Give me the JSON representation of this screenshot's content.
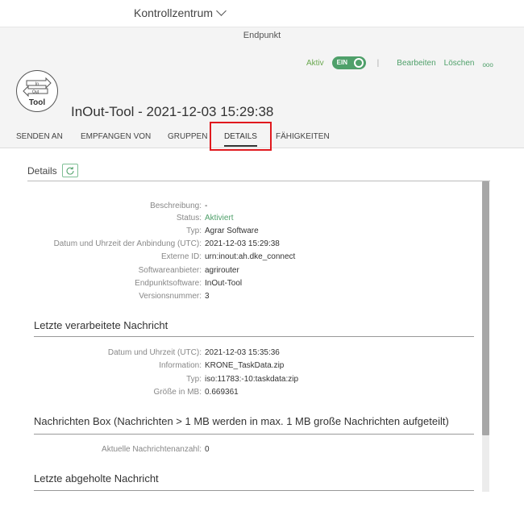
{
  "topbar": {
    "title": "Kontrollzentrum"
  },
  "subbar": {
    "label": "Endpunkt"
  },
  "header": {
    "logo_text": "Tool",
    "logo_in": "In",
    "logo_out": "Out",
    "title": "InOut-Tool - 2021-12-03 15:29:38",
    "status_label": "Aktiv",
    "toggle_label": "EIN",
    "edit_label": "Bearbeiten",
    "delete_label": "Löschen",
    "more_label": "ooo"
  },
  "tabs": [
    {
      "label": "SENDEN AN"
    },
    {
      "label": "EMPFANGEN VON"
    },
    {
      "label": "GRUPPEN"
    },
    {
      "label": "DETAILS",
      "active": true
    },
    {
      "label": "FÄHIGKEITEN"
    }
  ],
  "details": {
    "title": "Details",
    "rows": [
      {
        "key": "Beschreibung:",
        "value": "-"
      },
      {
        "key": "Status:",
        "value": "Aktiviert"
      },
      {
        "key": "Typ:",
        "value": "Agrar Software"
      },
      {
        "key": "Datum und Uhrzeit der Anbindung (UTC):",
        "value": "2021-12-03 15:29:38"
      },
      {
        "key": "Externe ID:",
        "value": "urn:inout:ah.dke_connect"
      },
      {
        "key": "Softwareanbieter:",
        "value": "agrirouter"
      },
      {
        "key": "Endpunktsoftware:",
        "value": "InOut-Tool"
      },
      {
        "key": "Versionsnummer:",
        "value": "3"
      }
    ]
  },
  "last_processed": {
    "title": "Letzte verarbeitete Nachricht",
    "rows": [
      {
        "key": "Datum und Uhrzeit (UTC):",
        "value": "2021-12-03 15:35:36"
      },
      {
        "key": "Information:",
        "value": "KRONE_TaskData.zip"
      },
      {
        "key": "Typ:",
        "value": "iso:11783:-10:taskdata:zip"
      },
      {
        "key": "Größe in MB:",
        "value": "0.669361"
      }
    ]
  },
  "message_box": {
    "title": "Nachrichten Box (Nachrichten > 1 MB werden in max. 1 MB große Nachrichten aufgeteilt)",
    "rows": [
      {
        "key": "Aktuelle Nachrichtenanzahl:",
        "value": "0"
      }
    ]
  },
  "last_fetched": {
    "title": "Letzte abgeholte Nachricht"
  },
  "colors": {
    "accent_green": "#4fa06a",
    "highlight_red": "#e0191e"
  }
}
